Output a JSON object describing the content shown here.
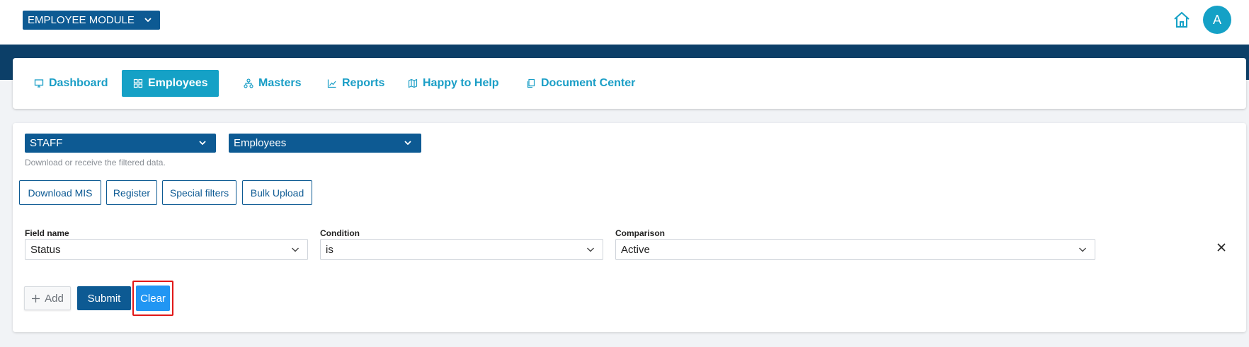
{
  "header": {
    "module_label": "EMPLOYEE MODULE",
    "avatar_initial": "A"
  },
  "nav": {
    "items": [
      {
        "label": "Dashboard",
        "icon": "monitor-icon"
      },
      {
        "label": "Employees",
        "icon": "grid-icon",
        "active": true
      },
      {
        "label": "Masters",
        "icon": "hierarchy-icon"
      },
      {
        "label": "Reports",
        "icon": "chart-line-icon"
      },
      {
        "label": "Happy to Help",
        "icon": "map-icon"
      },
      {
        "label": "Document Center",
        "icon": "documents-icon"
      }
    ]
  },
  "filters": {
    "category": "STAFF",
    "entity": "Employees",
    "hint": "Download or receive the filtered data."
  },
  "actions": {
    "download_mis": "Download MIS",
    "register": "Register",
    "special_filters": "Special filters",
    "bulk_upload": "Bulk Upload"
  },
  "condition_row": {
    "field_label": "Field name",
    "field_value": "Status",
    "condition_label": "Condition",
    "condition_value": "is",
    "comparison_label": "Comparison",
    "comparison_value": "Active"
  },
  "form_buttons": {
    "add": "Add",
    "submit": "Submit",
    "clear": "Clear"
  },
  "colors": {
    "brand_dark": "#0d5a93",
    "accent": "#15a1c6",
    "clear_button": "#2196f3",
    "highlight": "#e11818"
  }
}
